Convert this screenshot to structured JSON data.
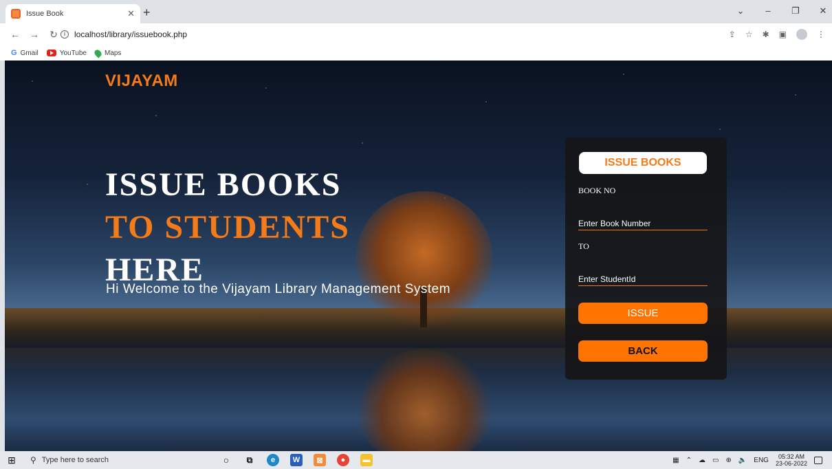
{
  "browser": {
    "tab_title": "Issue Book",
    "url": "localhost/library/issuebook.php",
    "bookmarks": [
      "Gmail",
      "YouTube",
      "Maps"
    ]
  },
  "page": {
    "brand": "VIJAYAM",
    "hero": {
      "line1": "ISSUE BOOKS",
      "line2": "TO STUDENTS",
      "line3": "HERE"
    },
    "welcome": "Hi Welcome to the Vijayam Library Management System",
    "form": {
      "title": "ISSUE BOOKS",
      "book_label": "BOOK NO",
      "book_placeholder": "Enter Book Number",
      "to_label": "TO",
      "student_placeholder": "Enter StudentId",
      "issue_button": "ISSUE",
      "back_button": "BACK"
    },
    "accent_color": "#f47b1a"
  },
  "taskbar": {
    "search_placeholder": "Type here to search",
    "language": "ENG",
    "time": "05:32 AM",
    "date": "23-06-2022"
  }
}
